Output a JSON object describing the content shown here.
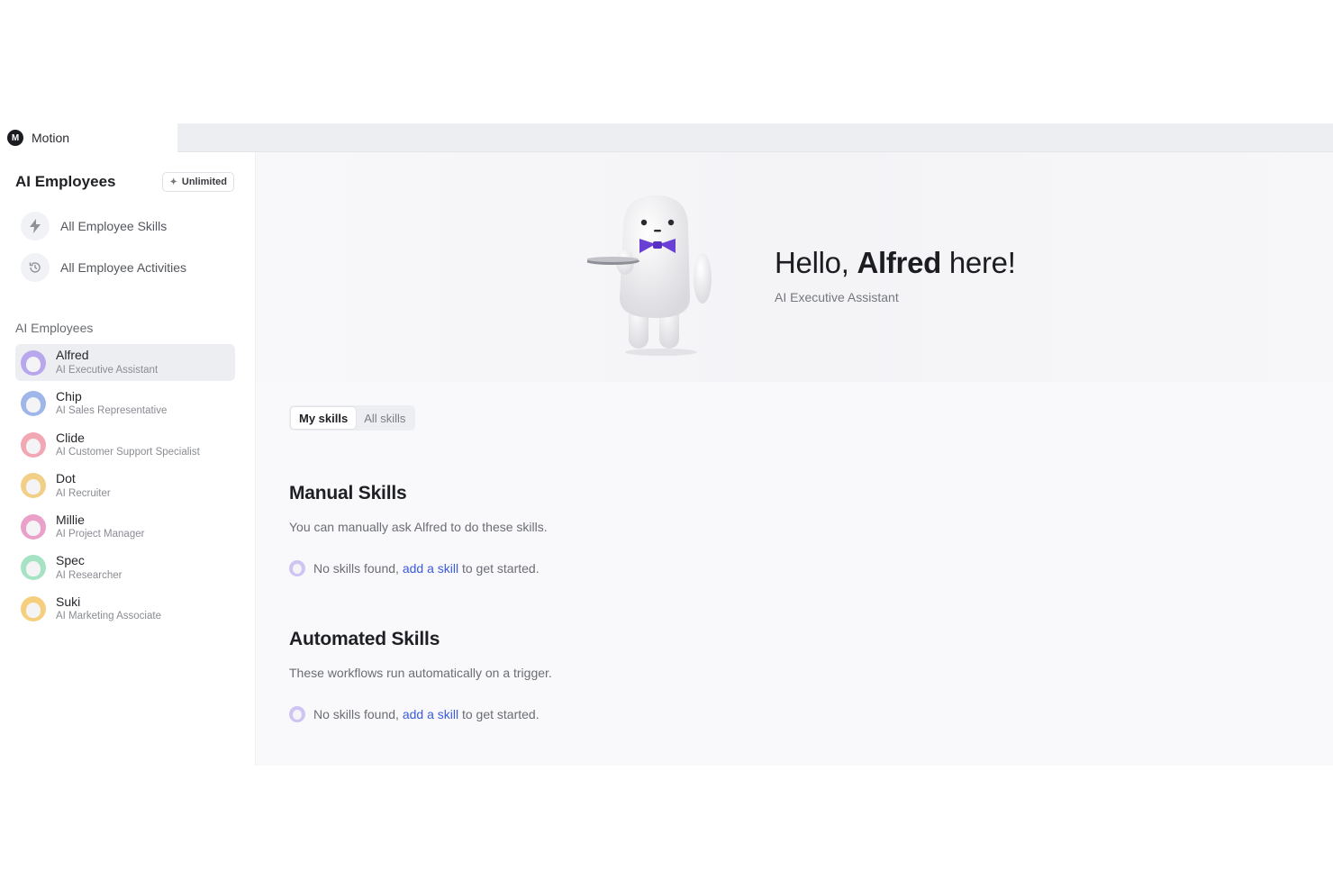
{
  "app": {
    "name": "Motion",
    "logo_letter": "M"
  },
  "sidebar": {
    "title": "AI Employees",
    "badge": {
      "label": "Unlimited",
      "icon": "sparkle-icon"
    },
    "nav": [
      {
        "label": "All Employee Skills",
        "icon": "lightning-icon"
      },
      {
        "label": "All Employee Activities",
        "icon": "history-icon"
      }
    ],
    "section_label": "AI Employees",
    "employees": [
      {
        "name": "Alfred",
        "role": "AI Executive Assistant",
        "color": "#b9a7ee",
        "active": true
      },
      {
        "name": "Chip",
        "role": "AI Sales Representative",
        "color": "#9fb6ea",
        "active": false
      },
      {
        "name": "Clide",
        "role": "AI Customer Support Specialist",
        "color": "#f2a7b4",
        "active": false
      },
      {
        "name": "Dot",
        "role": "AI Recruiter",
        "color": "#f1cf86",
        "active": false
      },
      {
        "name": "Millie",
        "role": "AI Project Manager",
        "color": "#eaa0c8",
        "active": false
      },
      {
        "name": "Spec",
        "role": "AI Researcher",
        "color": "#a6e3c4",
        "active": false
      },
      {
        "name": "Suki",
        "role": "AI Marketing Associate",
        "color": "#f5cf7d",
        "active": false
      }
    ]
  },
  "hero": {
    "greeting_prefix": "Hello, ",
    "greeting_name": "Alfred",
    "greeting_suffix": " here!",
    "subtitle": "AI Executive Assistant",
    "accent": "#6a3fd6"
  },
  "tabs": [
    {
      "label": "My skills",
      "active": true
    },
    {
      "label": "All skills",
      "active": false
    }
  ],
  "manual": {
    "title": "Manual Skills",
    "description": "You can manually ask Alfred to do these skills.",
    "empty_prefix": "No skills found, ",
    "empty_link": "add a skill",
    "empty_suffix": " to get started."
  },
  "automated": {
    "title": "Automated Skills",
    "description": "These workflows run automatically on a trigger.",
    "empty_prefix": "No skills found, ",
    "empty_link": "add a skill",
    "empty_suffix": " to get started."
  }
}
